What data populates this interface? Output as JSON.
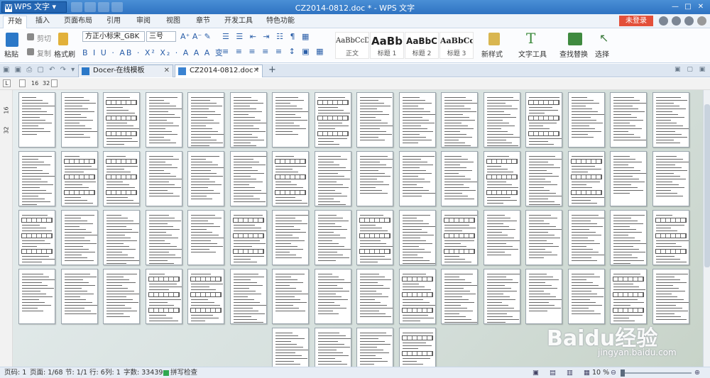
{
  "app": {
    "name": "WPS 文字",
    "window_title": "CZ2014-0812.doc * - WPS 文字",
    "login": "未登录"
  },
  "menu": [
    "开始",
    "插入",
    "页面布局",
    "引用",
    "审阅",
    "视图",
    "章节",
    "开发工具",
    "特色功能"
  ],
  "ribbon": {
    "paste": "粘贴",
    "cut": "剪切",
    "copy": "复制",
    "format_painter": "格式刷",
    "font_name": "方正小标宋_GBK",
    "font_size": "三号",
    "styles": [
      {
        "preview": "AaBbCcDd",
        "name": "正文"
      },
      {
        "preview": "AaBb",
        "name": "标题 1"
      },
      {
        "preview": "AaBbC",
        "name": "标题 2"
      },
      {
        "preview": "AaBbCcI",
        "name": "标题 3"
      }
    ],
    "new_style": "新样式",
    "text_tools": "文字工具",
    "find_replace": "查找替换",
    "select": "选择"
  },
  "tabs": [
    {
      "label": "Docer-在线模板",
      "active": false
    },
    {
      "label": "CZ2014-0812.doc *",
      "active": true
    }
  ],
  "ruler": {
    "marks": [
      "16",
      "32"
    ]
  },
  "vruler": {
    "marks": [
      "16",
      "32"
    ]
  },
  "status": {
    "page_num": "页码: 1",
    "page_of": "页面: 1/68",
    "section": "节: 1/1",
    "row": "行: 6",
    "col": "列: 1",
    "words": "字数: 33439",
    "spell": "拼写检查",
    "zoom": "10 %"
  },
  "watermark": {
    "brand": "Baidu经验",
    "url": "jingyan.baidu.com"
  },
  "colors": {
    "title_bar": "#3a80cc",
    "accent": "#2466b3",
    "login": "#e3503a"
  }
}
